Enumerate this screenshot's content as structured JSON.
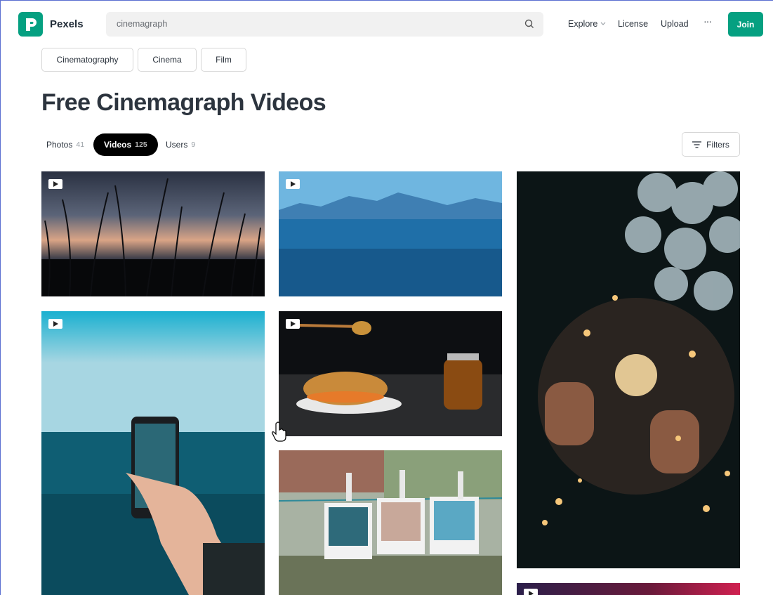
{
  "header": {
    "brand": "Pexels",
    "search_value": "cinemagraph",
    "nav": {
      "explore": "Explore",
      "license": "License",
      "upload": "Upload",
      "more": "···"
    },
    "join_label": "Join"
  },
  "related_chips": [
    "Cinematography",
    "Cinema",
    "Film"
  ],
  "page_title": "Free Cinemagraph Videos",
  "tabs": [
    {
      "label": "Photos",
      "count": "41"
    },
    {
      "label": "Videos",
      "count": "125"
    },
    {
      "label": "Users",
      "count": "9"
    }
  ],
  "filters_label": "Filters",
  "colors": {
    "brand": "#05a081",
    "active_tab": "#000000"
  }
}
